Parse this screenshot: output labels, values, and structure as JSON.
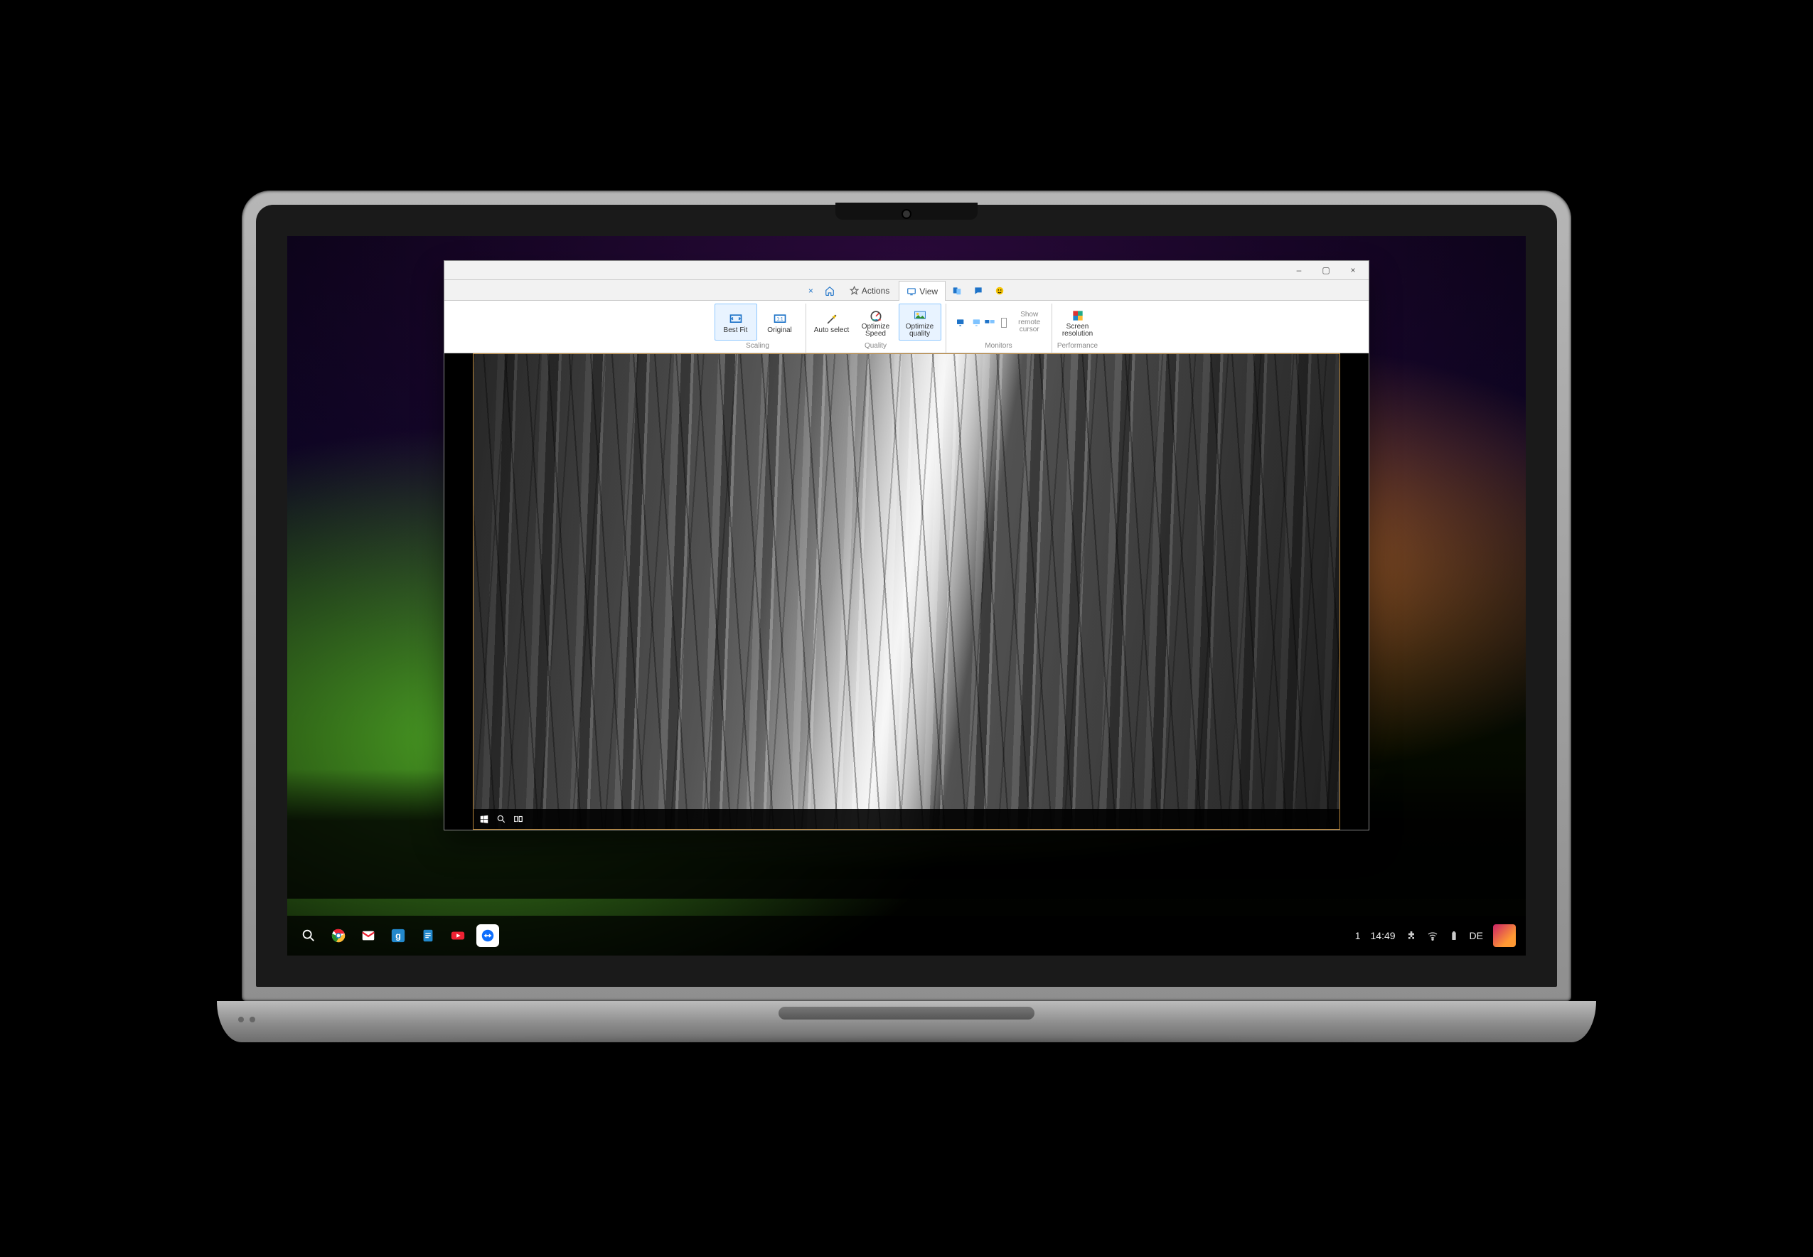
{
  "remote_window": {
    "titlebar": {
      "minimize": "–",
      "maximize": "▢",
      "close": "×"
    },
    "tabs": {
      "close_session": "×",
      "actions": "Actions",
      "view": "View",
      "active": "view"
    },
    "ribbon": {
      "groups": [
        {
          "label": "Scaling",
          "items": [
            {
              "key": "best_fit",
              "label": "Best Fit",
              "active": true
            },
            {
              "key": "original",
              "label": "Original"
            }
          ]
        },
        {
          "label": "Quality",
          "items": [
            {
              "key": "auto_select",
              "label": "Auto select"
            },
            {
              "key": "optimize_speed",
              "label": "Optimize Speed"
            },
            {
              "key": "optimize_quality",
              "label": "Optimize quality",
              "active": true
            }
          ]
        },
        {
          "label": "Monitors",
          "items": [
            {
              "key": "show_remote_cursor",
              "label": "Show remote cursor",
              "disabled": true,
              "checkbox": true
            }
          ]
        },
        {
          "label": "Performance",
          "items": [
            {
              "key": "screen_resolution",
              "label": "Screen resolution"
            }
          ]
        }
      ]
    },
    "remote_os": "windows",
    "remote_taskbar": {
      "start": "Windows",
      "search": "Search",
      "taskview": "Task view"
    }
  },
  "chromeos_shelf": {
    "apps": [
      "launcher",
      "chrome",
      "gmail",
      "google",
      "docs",
      "youtube",
      "teamviewer"
    ],
    "status": {
      "notifications": "1",
      "time": "14:49",
      "locale": "DE"
    }
  }
}
